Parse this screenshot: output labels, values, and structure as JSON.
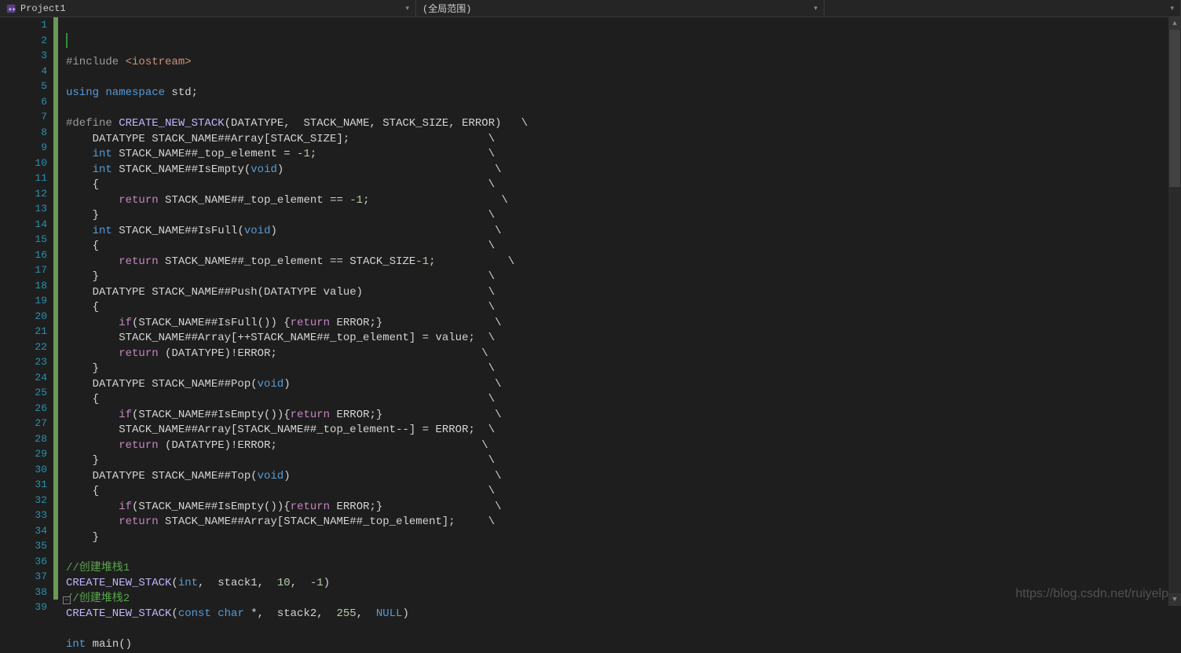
{
  "topbar": {
    "project": "Project1",
    "scope": "(全局范围)",
    "member": ""
  },
  "gutter": {
    "start": 1,
    "end": 39
  },
  "code": [
    {
      "n": 1,
      "g": true,
      "tokens": [
        [
          "kw-pre",
          "#include "
        ],
        [
          "str-inc",
          "<iostream>"
        ]
      ]
    },
    {
      "n": 2,
      "g": true,
      "tokens": []
    },
    {
      "n": 3,
      "g": true,
      "tokens": [
        [
          "kw-blue",
          "using namespace"
        ],
        [
          "ident",
          " std;"
        ]
      ]
    },
    {
      "n": 4,
      "g": true,
      "tokens": []
    },
    {
      "n": 5,
      "g": true,
      "tokens": [
        [
          "def-kw",
          "#define "
        ],
        [
          "macro",
          "CREATE_NEW_STACK"
        ],
        [
          "paren",
          "(DATATYPE,  STACK_NAME, STACK_SIZE, ERROR)   \\"
        ]
      ]
    },
    {
      "n": 6,
      "g": true,
      "tokens": [
        [
          "ident",
          "    DATATYPE STACK_NAME##Array[STACK_SIZE];                     \\"
        ]
      ]
    },
    {
      "n": 7,
      "g": true,
      "tokens": [
        [
          "ident",
          "    "
        ],
        [
          "kw-type",
          "int"
        ],
        [
          "ident",
          " STACK_NAME##_top_element = "
        ],
        [
          "num",
          "-1"
        ],
        [
          "ident",
          ";                          \\"
        ]
      ]
    },
    {
      "n": 8,
      "g": true,
      "tokens": [
        [
          "ident",
          "    "
        ],
        [
          "kw-type",
          "int"
        ],
        [
          "ident",
          " STACK_NAME##IsEmpty("
        ],
        [
          "kw-type",
          "void"
        ],
        [
          "ident",
          ")                                \\"
        ]
      ]
    },
    {
      "n": 9,
      "g": true,
      "tokens": [
        [
          "ident",
          "    {                                                           \\"
        ]
      ]
    },
    {
      "n": 10,
      "g": true,
      "tokens": [
        [
          "ident",
          "        "
        ],
        [
          "kw-flow",
          "return"
        ],
        [
          "ident",
          " STACK_NAME##_top_element == "
        ],
        [
          "num",
          "-1"
        ],
        [
          "ident",
          ";                    \\"
        ]
      ]
    },
    {
      "n": 11,
      "g": true,
      "tokens": [
        [
          "ident",
          "    }                                                           \\"
        ]
      ]
    },
    {
      "n": 12,
      "g": true,
      "tokens": [
        [
          "ident",
          "    "
        ],
        [
          "kw-type",
          "int"
        ],
        [
          "ident",
          " STACK_NAME##IsFull("
        ],
        [
          "kw-type",
          "void"
        ],
        [
          "ident",
          ")                                 \\"
        ]
      ]
    },
    {
      "n": 13,
      "g": true,
      "tokens": [
        [
          "ident",
          "    {                                                           \\"
        ]
      ]
    },
    {
      "n": 14,
      "g": true,
      "tokens": [
        [
          "ident",
          "        "
        ],
        [
          "kw-flow",
          "return"
        ],
        [
          "ident",
          " STACK_NAME##_top_element == STACK_SIZE"
        ],
        [
          "num",
          "-1"
        ],
        [
          "ident",
          ";           \\"
        ]
      ]
    },
    {
      "n": 15,
      "g": true,
      "tokens": [
        [
          "ident",
          "    }                                                           \\"
        ]
      ]
    },
    {
      "n": 16,
      "g": true,
      "tokens": [
        [
          "ident",
          "    DATATYPE STACK_NAME##Push(DATATYPE value)                   \\"
        ]
      ]
    },
    {
      "n": 17,
      "g": true,
      "tokens": [
        [
          "ident",
          "    {                                                           \\"
        ]
      ]
    },
    {
      "n": 18,
      "g": true,
      "tokens": [
        [
          "ident",
          "        "
        ],
        [
          "kw-flow",
          "if"
        ],
        [
          "ident",
          "(STACK_NAME##IsFull()) {"
        ],
        [
          "kw-flow",
          "return"
        ],
        [
          "ident",
          " ERROR;}                 \\"
        ]
      ]
    },
    {
      "n": 19,
      "g": true,
      "tokens": [
        [
          "ident",
          "        STACK_NAME##Array[++STACK_NAME##_top_element] = value;  \\"
        ]
      ]
    },
    {
      "n": 20,
      "g": true,
      "tokens": [
        [
          "ident",
          "        "
        ],
        [
          "kw-flow",
          "return"
        ],
        [
          "ident",
          " (DATATYPE)!ERROR;                               \\"
        ]
      ]
    },
    {
      "n": 21,
      "g": true,
      "tokens": [
        [
          "ident",
          "    }                                                           \\"
        ]
      ]
    },
    {
      "n": 22,
      "g": true,
      "tokens": [
        [
          "ident",
          "    DATATYPE STACK_NAME##Pop("
        ],
        [
          "kw-type",
          "void"
        ],
        [
          "ident",
          ")                               \\"
        ]
      ]
    },
    {
      "n": 23,
      "g": true,
      "tokens": [
        [
          "ident",
          "    {                                                           \\"
        ]
      ]
    },
    {
      "n": 24,
      "g": true,
      "tokens": [
        [
          "ident",
          "        "
        ],
        [
          "kw-flow",
          "if"
        ],
        [
          "ident",
          "(STACK_NAME##IsEmpty()){"
        ],
        [
          "kw-flow",
          "return"
        ],
        [
          "ident",
          " ERROR;}                 \\"
        ]
      ]
    },
    {
      "n": 25,
      "g": true,
      "tokens": [
        [
          "ident",
          "        STACK_NAME##Array[STACK_NAME##_top_element--] = ERROR;  \\"
        ]
      ]
    },
    {
      "n": 26,
      "g": true,
      "tokens": [
        [
          "ident",
          "        "
        ],
        [
          "kw-flow",
          "return"
        ],
        [
          "ident",
          " (DATATYPE)!ERROR;                               \\"
        ]
      ]
    },
    {
      "n": 27,
      "g": true,
      "tokens": [
        [
          "ident",
          "    }                                                           \\"
        ]
      ]
    },
    {
      "n": 28,
      "g": true,
      "tokens": [
        [
          "ident",
          "    DATATYPE STACK_NAME##Top("
        ],
        [
          "kw-type",
          "void"
        ],
        [
          "ident",
          ")                               \\"
        ]
      ]
    },
    {
      "n": 29,
      "g": true,
      "tokens": [
        [
          "ident",
          "    {                                                           \\"
        ]
      ]
    },
    {
      "n": 30,
      "g": true,
      "tokens": [
        [
          "ident",
          "        "
        ],
        [
          "kw-flow",
          "if"
        ],
        [
          "ident",
          "(STACK_NAME##IsEmpty()){"
        ],
        [
          "kw-flow",
          "return"
        ],
        [
          "ident",
          " ERROR;}                 \\"
        ]
      ]
    },
    {
      "n": 31,
      "g": true,
      "tokens": [
        [
          "ident",
          "        "
        ],
        [
          "kw-flow",
          "return"
        ],
        [
          "ident",
          " STACK_NAME##Array[STACK_NAME##_top_element];     \\"
        ]
      ]
    },
    {
      "n": 32,
      "g": true,
      "tokens": [
        [
          "ident",
          "    }                                                           "
        ]
      ]
    },
    {
      "n": 33,
      "g": true,
      "tokens": []
    },
    {
      "n": 34,
      "g": true,
      "tokens": [
        [
          "cmt",
          "//创建堆栈1"
        ]
      ]
    },
    {
      "n": 35,
      "g": true,
      "tokens": [
        [
          "macro",
          "CREATE_NEW_STACK"
        ],
        [
          "paren",
          "("
        ],
        [
          "kw-type",
          "int"
        ],
        [
          "ident",
          ",  stack1,  "
        ],
        [
          "num",
          "10"
        ],
        [
          "ident",
          ",  "
        ],
        [
          "num",
          "-1"
        ],
        [
          "paren",
          ")"
        ]
      ]
    },
    {
      "n": 36,
      "g": true,
      "tokens": [
        [
          "cmt",
          "//创建堆栈2"
        ]
      ]
    },
    {
      "n": 37,
      "g": true,
      "tokens": [
        [
          "macro",
          "CREATE_NEW_STACK"
        ],
        [
          "paren",
          "("
        ],
        [
          "kw-type",
          "const char"
        ],
        [
          "ident",
          " *,  stack2,  "
        ],
        [
          "num",
          "255"
        ],
        [
          "ident",
          ",  "
        ],
        [
          "kw-type",
          "NULL"
        ],
        [
          "paren",
          ")"
        ]
      ]
    },
    {
      "n": 38,
      "g": true,
      "tokens": []
    },
    {
      "n": 39,
      "g": false,
      "tokens": [
        [
          "kw-type",
          "int"
        ],
        [
          "ident",
          " main()"
        ]
      ]
    }
  ],
  "watermark": "https://blog.csdn.net/ruiyelp"
}
